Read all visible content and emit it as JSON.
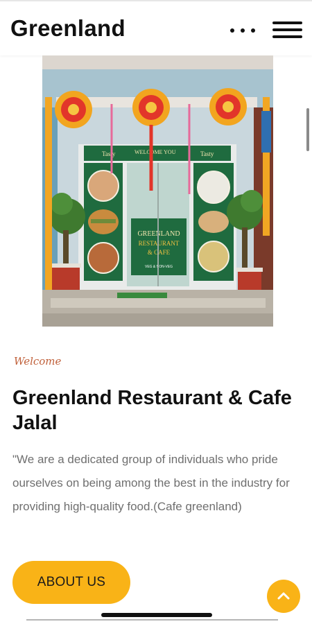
{
  "header": {
    "brand": "Greenland",
    "more_icon": "more-dots-icon",
    "menu_icon": "hamburger-menu-icon"
  },
  "hero": {
    "sign_line1": "GREENLAND",
    "sign_line2": "RESTAURANT",
    "sign_line3": "& CAFE",
    "sign_line4": "VEG & NON-VEG",
    "banner_left": "Tasty",
    "banner_mid": "WELCOME YOU",
    "banner_right": "Tasty"
  },
  "intro": {
    "eyebrow": "Welcome",
    "title": "Greenland Restaurant & Cafe Jalal",
    "description": "\"We are a dedicated group of individuals who pride ourselves on being among the best in the industry for providing high-quality food.(Cafe greenland)",
    "about_label": "ABOUT US"
  },
  "scroll_top_icon": "chevron-up-icon",
  "colors": {
    "accent": "#f9b317",
    "eyebrow": "#c0603a",
    "body_text": "#6f6f6f",
    "sign_green": "#1f6b3f"
  }
}
